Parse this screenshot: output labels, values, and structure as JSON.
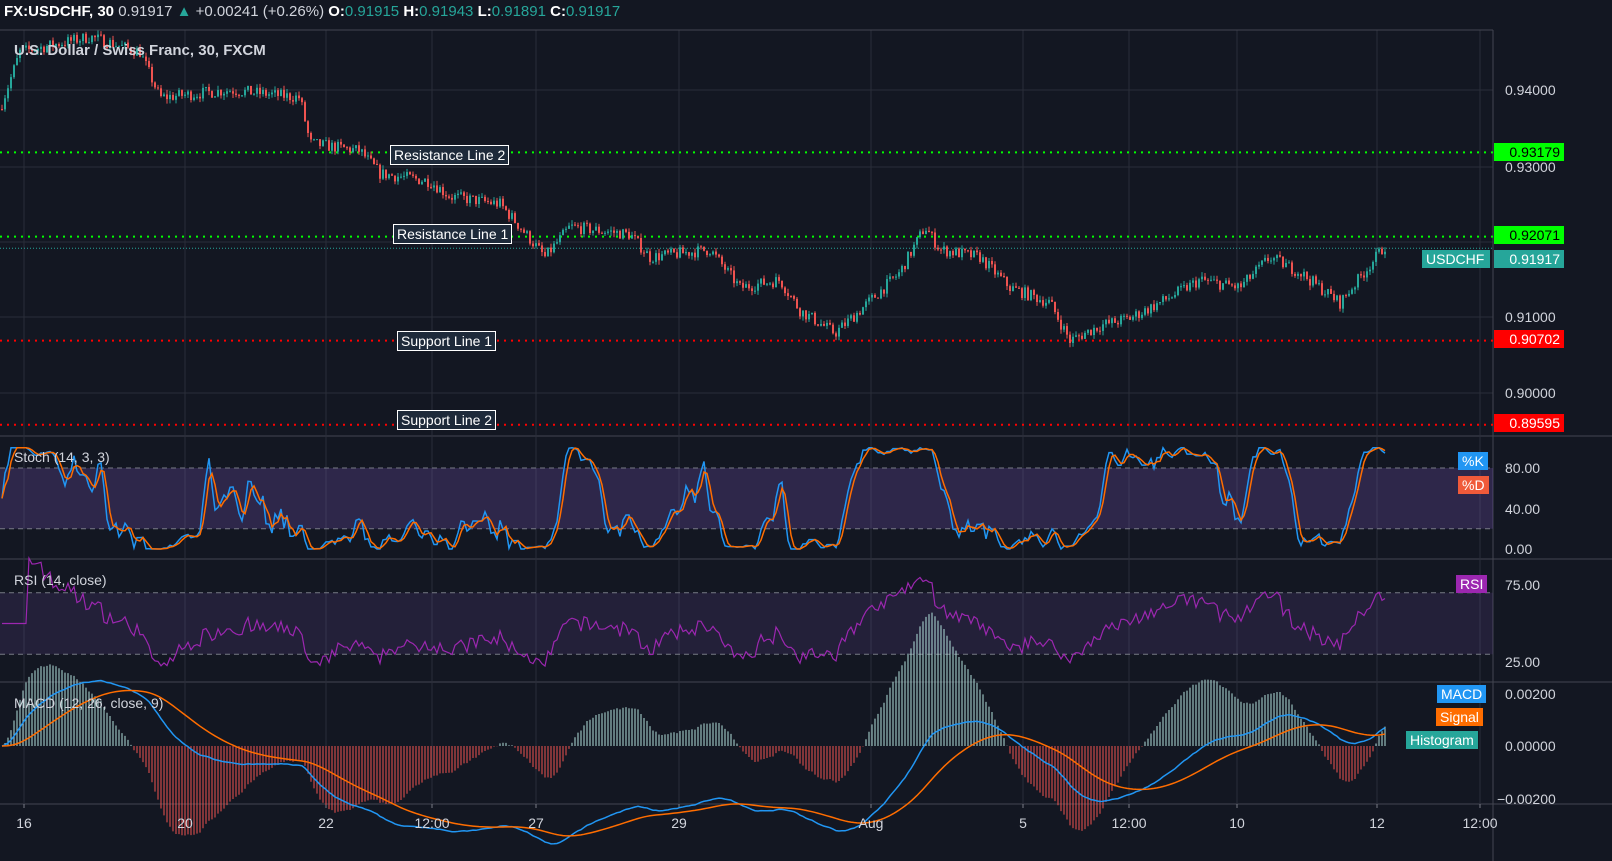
{
  "header": {
    "symbol": "FX:USDCHF, 30",
    "last": "0.91917",
    "change": "+0.00241 (+0.26%)",
    "o_label": "O:",
    "o": "0.91915",
    "h_label": "H:",
    "h": "0.91943",
    "l_label": "L:",
    "l": "0.91891",
    "c_label": "C:",
    "c": "0.91917"
  },
  "subtitle": "U.S. Dollar / Swiss Franc, 30, FXCM",
  "levels": [
    {
      "name": "Resistance Line 2",
      "price": 0.93179,
      "label": "0.93179",
      "color": "#00ff00"
    },
    {
      "name": "Resistance Line 1",
      "price": 0.92071,
      "label": "0.92071",
      "color": "#00ff00"
    },
    {
      "name": "Support Line 1",
      "price": 0.90702,
      "label": "0.90702",
      "color": "#ff0000"
    },
    {
      "name": "Support Line 2",
      "price": 0.89595,
      "label": "0.89595",
      "color": "#ff0000"
    }
  ],
  "current": {
    "symbol": "USDCHF",
    "price": "0.91917"
  },
  "price_axis": [
    "0.94000",
    "0.93000",
    "0.91000",
    "0.90000"
  ],
  "stoch": {
    "title": "Stoch (14, 3, 3)",
    "k": "%K",
    "d": "%D",
    "axis": [
      "80.00",
      "40.00",
      "0.00"
    ]
  },
  "rsi": {
    "title": "RSI (14, close)",
    "tag": "RSI",
    "axis": [
      "75.00",
      "25.00"
    ]
  },
  "macd": {
    "title": "MACD (12, 26, close, 9)",
    "macd": "MACD",
    "signal": "Signal",
    "hist": "Histogram",
    "axis": [
      "0.00200",
      "0.00000",
      "−0.00200"
    ]
  },
  "time_axis": [
    "16",
    "20",
    "22",
    "12:00",
    "27",
    "29",
    "Aug",
    "5",
    "12:00",
    "10",
    "12",
    "12:00"
  ],
  "colors": {
    "up": "#26a69a",
    "down": "#ef5350",
    "k": "#2196f3",
    "d": "#ff6d00",
    "rsi": "#9c27b0"
  }
}
